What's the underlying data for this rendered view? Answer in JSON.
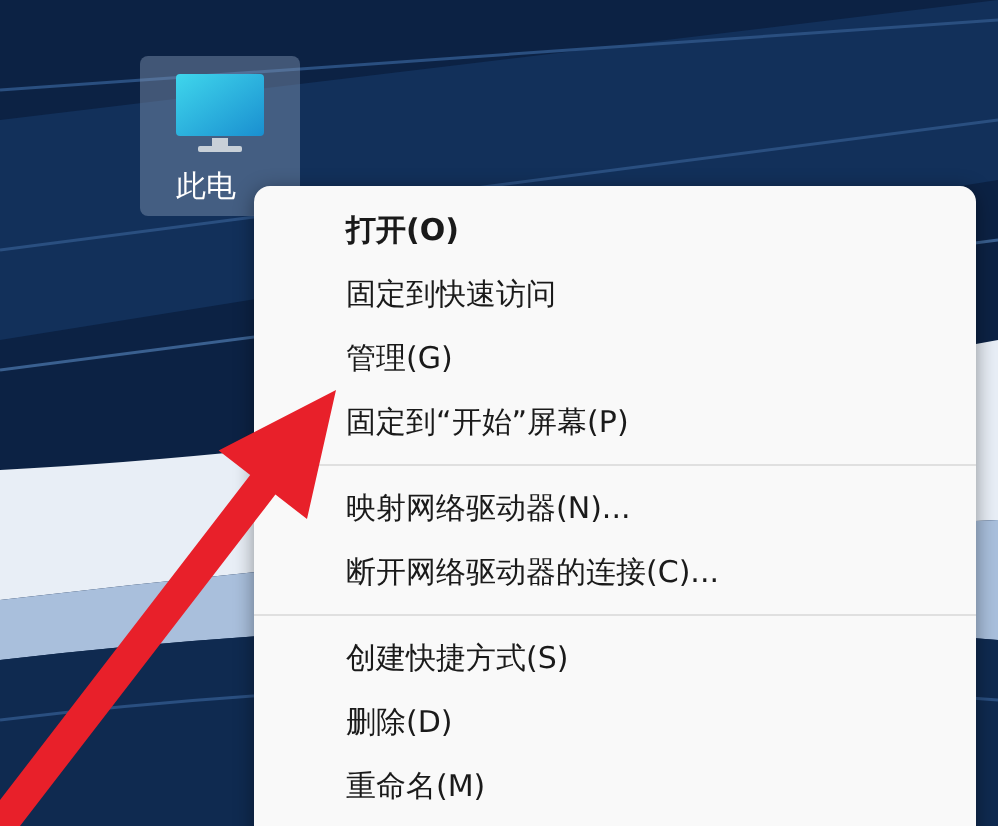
{
  "desktop_icon": {
    "label": "此电",
    "selected": true
  },
  "context_menu": {
    "groups": [
      [
        {
          "label": "打开(O)",
          "default": true
        },
        {
          "label": "固定到快速访问",
          "default": false
        },
        {
          "label": "管理(G)",
          "default": false
        },
        {
          "label": "固定到“开始”屏幕(P)",
          "default": false
        }
      ],
      [
        {
          "label": "映射网络驱动器(N)...",
          "default": false
        },
        {
          "label": "断开网络驱动器的连接(C)...",
          "default": false
        }
      ],
      [
        {
          "label": "创建快捷方式(S)",
          "default": false
        },
        {
          "label": "删除(D)",
          "default": false
        },
        {
          "label": "重命名(M)",
          "default": false
        }
      ]
    ]
  }
}
